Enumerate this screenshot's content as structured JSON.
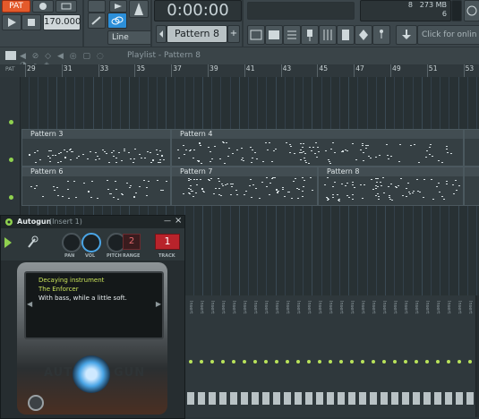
{
  "toolbar": {
    "pattern_mode_label": "PAT",
    "tempo": "170.000",
    "time_display": "0:00:00",
    "time_small": "000",
    "snap_label": "Line",
    "pattern_selector": "Pattern 8",
    "memory_top": "8",
    "memory_value": "273 MB",
    "cpu_value": "6",
    "online_label": "Click for onlin"
  },
  "playlist": {
    "breadcrumb": "Playlist - Pattern 8",
    "ruler_marks": [
      "29",
      "31",
      "33",
      "35",
      "37",
      "39",
      "41",
      "43",
      "45",
      "47",
      "49",
      "51",
      "53"
    ]
  },
  "clips": [
    {
      "label": "Pattern 3"
    },
    {
      "label": "Pattern 4"
    },
    {
      "label": "Pattern 6"
    },
    {
      "label": "Pattern 7"
    },
    {
      "label": "Pattern 8"
    }
  ],
  "autogun": {
    "title": "Autogun",
    "insert": "(Insert 1)",
    "pan_label": "PAN",
    "vol_label": "VOL",
    "pitch_label": "PITCH",
    "range_label": "RANGE",
    "range_value": "2",
    "track_label": "TRACK",
    "track_value": "1",
    "screen_line1": "Decaying instrument",
    "screen_line2": "The Enforcer",
    "screen_line3": "With bass, while a little soft.",
    "brand_left": "AUT",
    "brand_right": "GUN"
  },
  "mixer": {
    "insert_label": "Insert"
  },
  "colors": {
    "accent_green": "#8fd14f",
    "toolbar_bg": "#3c464b",
    "playlist_bg": "#283134",
    "track_red": "#b8232b",
    "knob_blue": "#4aa5e6"
  }
}
